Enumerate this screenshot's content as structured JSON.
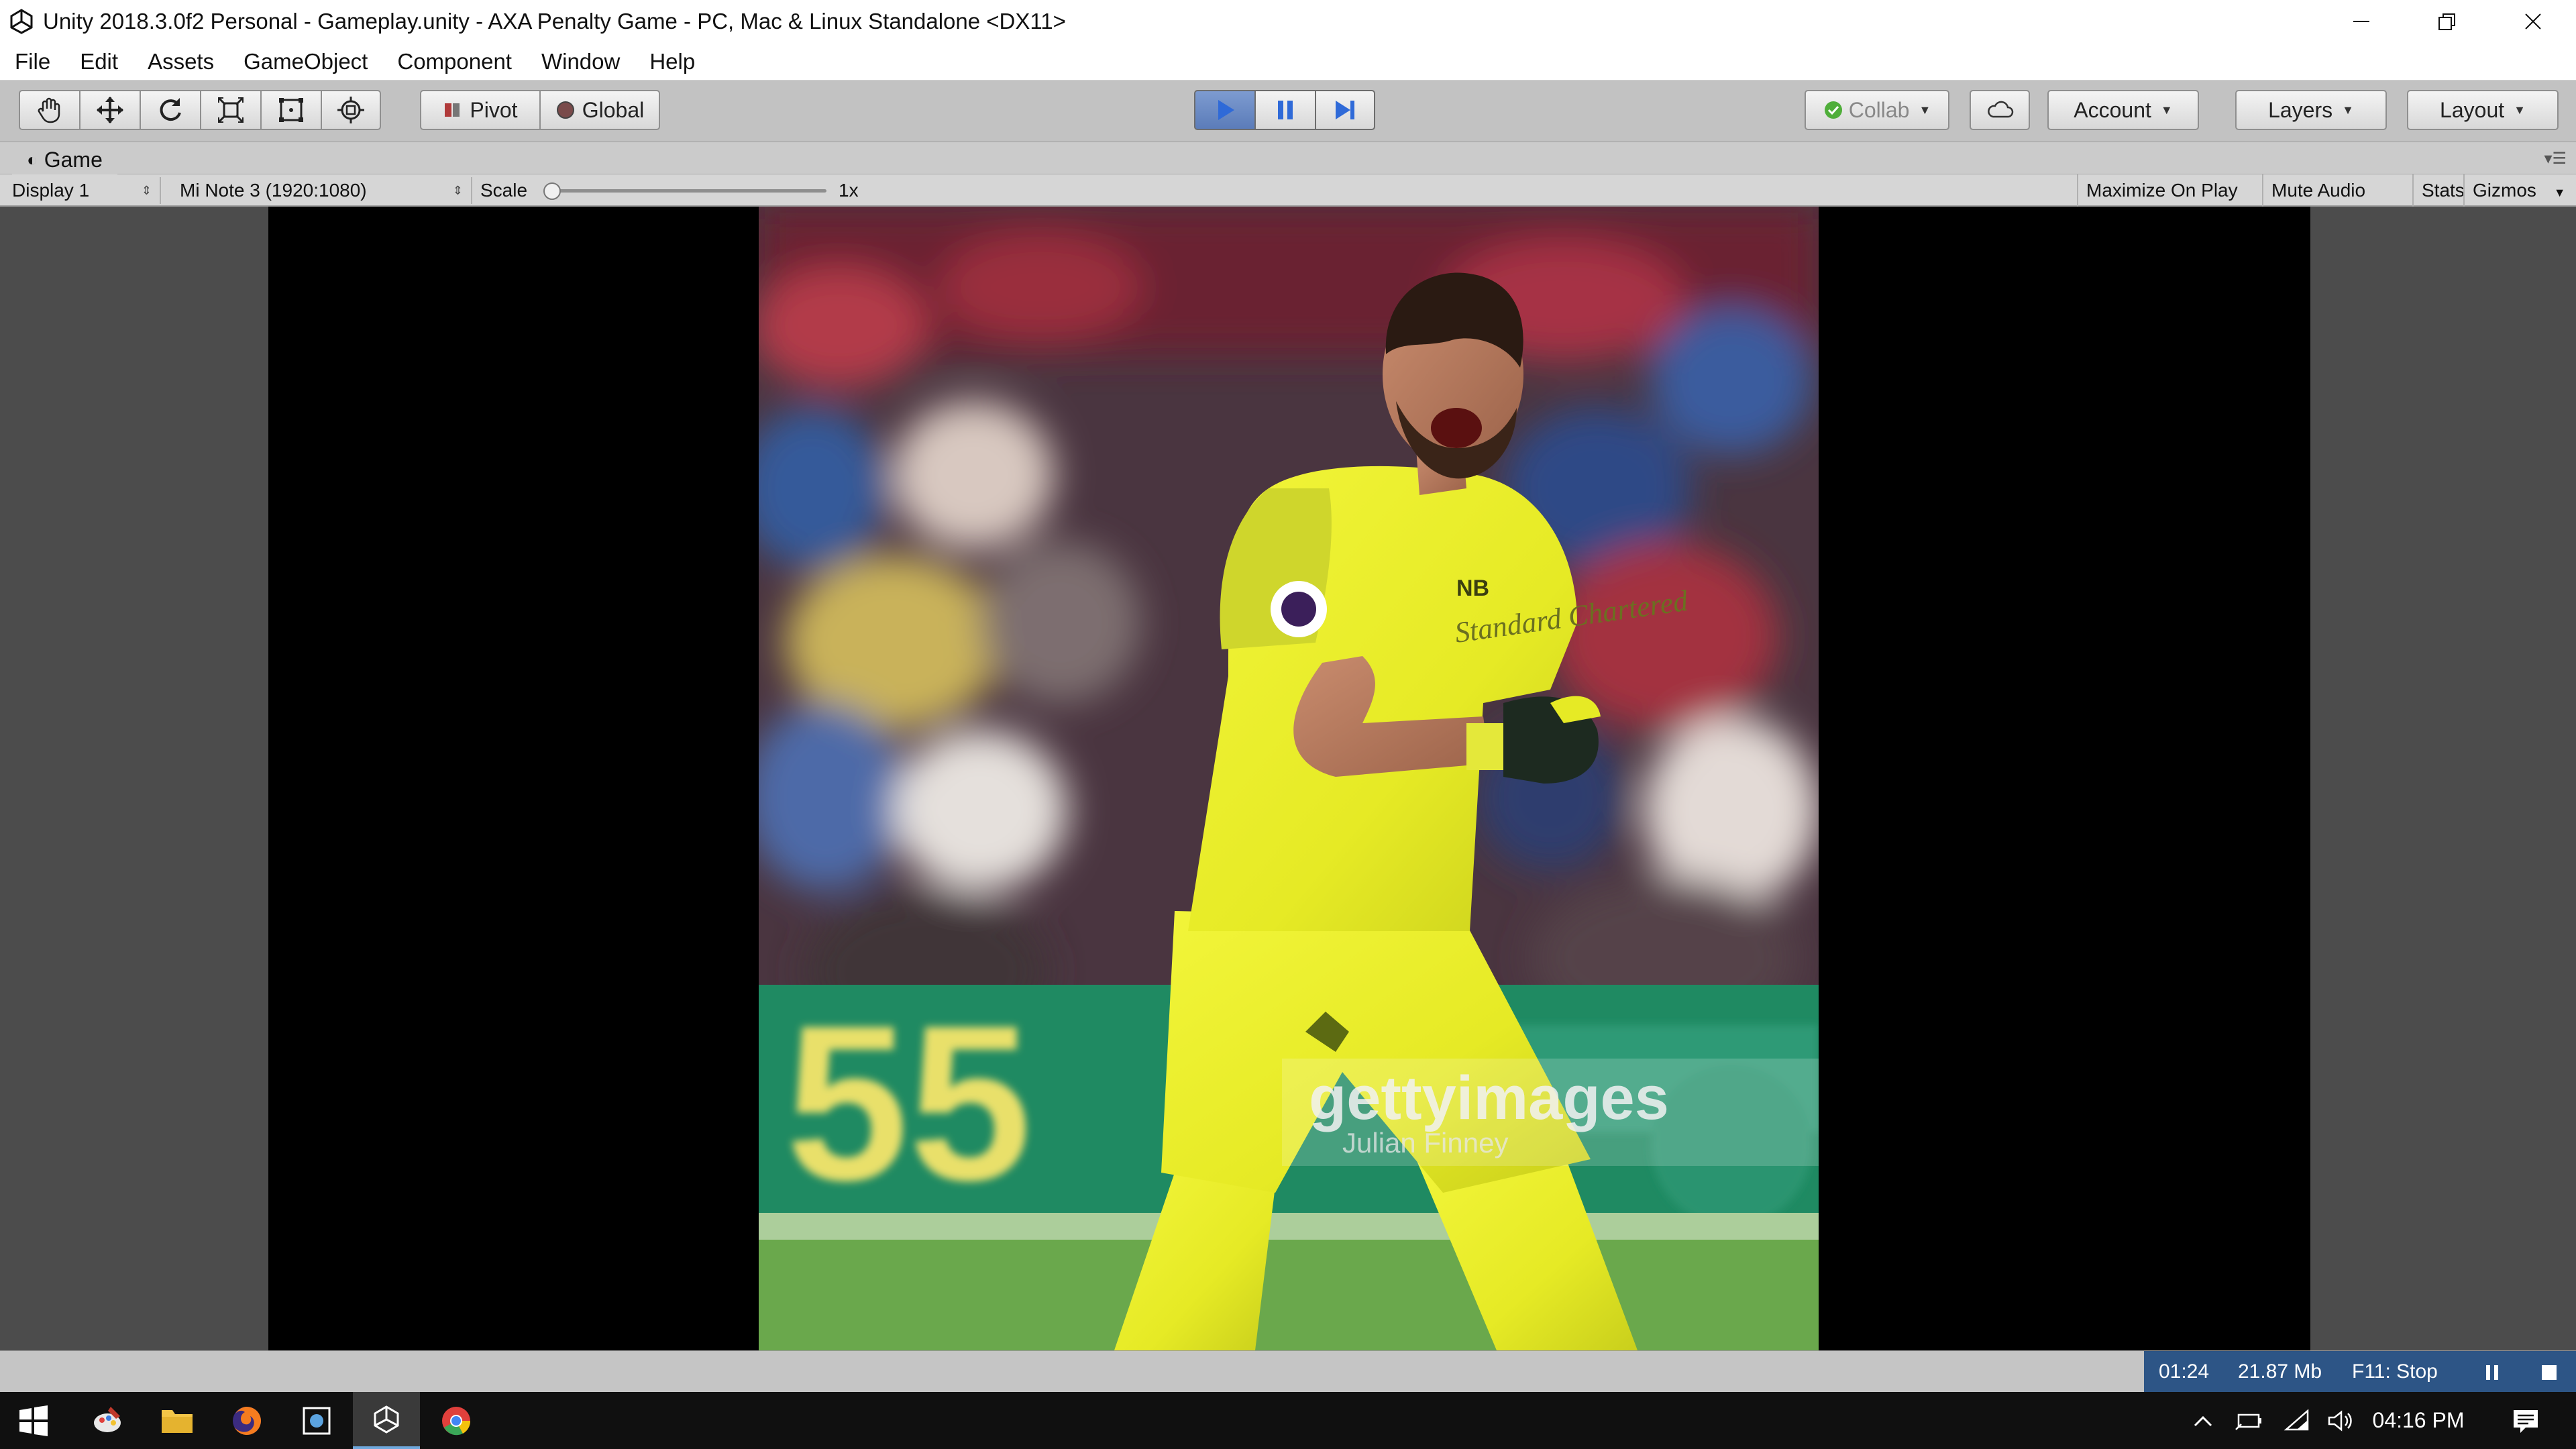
{
  "window": {
    "title": "Unity 2018.3.0f2 Personal - Gameplay.unity - AXA Penalty Game - PC, Mac & Linux Standalone <DX11>"
  },
  "menu": [
    "File",
    "Edit",
    "Assets",
    "GameObject",
    "Component",
    "Window",
    "Help"
  ],
  "toolbar": {
    "tools": [
      "hand-icon",
      "move-icon",
      "rotate-icon",
      "scale-icon",
      "rect-icon",
      "transform-icon"
    ],
    "pivot_label": "Pivot",
    "global_label": "Global",
    "collab_label": "Collab",
    "account_label": "Account",
    "layers_label": "Layers",
    "layout_label": "Layout",
    "accent": "#4a7bd0"
  },
  "game_panel": {
    "tab_label": "Game",
    "display": "Display 1",
    "resolution": "Mi Note 3 (1920:1080)",
    "scale_label": "Scale",
    "scale_value": "1x",
    "maximize_label": "Maximize On Play",
    "mute_label": "Mute Audio",
    "stats_label": "Stats",
    "gizmos_label": "Gizmos"
  },
  "photo": {
    "watermark": "gettyimages",
    "credit": "Julian Finney",
    "sponsor": "Standard Chartered",
    "board_text": "55"
  },
  "statusbar": {
    "time": "01:24",
    "memory": "21.87 Mb",
    "stop_hint": "F11: Stop",
    "color": "#2d5586"
  },
  "taskbar": {
    "clock": "04:16 PM"
  }
}
